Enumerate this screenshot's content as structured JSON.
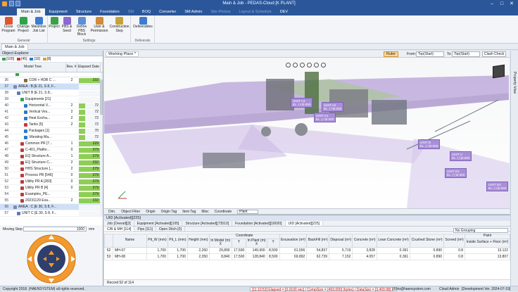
{
  "window": {
    "title": "Main & Job - PEDAS-Cloud [K PLANT]"
  },
  "ribbon_tabs": [
    {
      "label": "Main & Job",
      "state": "active"
    },
    {
      "label": "Equipment",
      "state": "normal"
    },
    {
      "label": "Structure",
      "state": "normal"
    },
    {
      "label": "Foundation",
      "state": "normal"
    },
    {
      "label": "SM",
      "state": "dim"
    },
    {
      "label": "BOQ",
      "state": "normal"
    },
    {
      "label": "Converter",
      "state": "normal"
    },
    {
      "label": "SM Admin",
      "state": "normal"
    },
    {
      "label": "Site Photos",
      "state": "dim"
    },
    {
      "label": "Layout & Schedule",
      "state": "dim"
    },
    {
      "label": "DEV",
      "state": "normal"
    }
  ],
  "ribbon": {
    "general": {
      "label": "General",
      "buttons": [
        "Close Program",
        "Change Project",
        "Maximize Job List"
      ]
    },
    "settings": {
      "label": "Settings",
      "buttons": [
        "Project",
        "PBS & Seed",
        "Define PBS Block",
        "User & Permission",
        "Construction Step"
      ]
    },
    "deliverables": {
      "label": "Deliverals",
      "buttons": [
        "Deliverables"
      ]
    }
  },
  "doc_tab": "Main & Job",
  "explorer": {
    "title": "Object Explorer",
    "counts": [
      "[105]",
      "[45]",
      "[19]",
      "[8]"
    ],
    "columns": {
      "model_tree": "Model Tree",
      "rev": "Rev. #",
      "elapsed": "Elapsed Date"
    },
    "rows": [
      {
        "num": "36",
        "name": "COR + HDB C ...",
        "rev": "2",
        "elapsed": "232",
        "fill": 1.0,
        "icon": "#8a6a3a",
        "indent": 4
      },
      {
        "num": "37",
        "name": "AREA : B [E 21, S 8, F...",
        "rev": "",
        "elapsed": "",
        "fill": 0,
        "icon": "#7a8ab8",
        "indent": 1,
        "selected": true
      },
      {
        "num": "38",
        "name": "UNIT B [E 21, S 8...",
        "rev": "",
        "elapsed": "",
        "fill": 0,
        "icon": "#5b7ab8",
        "indent": 2
      },
      {
        "num": "39",
        "name": "Equipments [21]",
        "rev": "",
        "elapsed": "",
        "fill": 0,
        "icon": "#3aa04a",
        "indent": 3
      },
      {
        "num": "40",
        "name": "Horizontal V...",
        "rev": "2",
        "elapsed": "72",
        "fill": 0.31,
        "icon": "#2b79c8",
        "indent": 4
      },
      {
        "num": "41",
        "name": "Vertical Ves...",
        "rev": "2",
        "elapsed": "72",
        "fill": 0.31,
        "icon": "#2b79c8",
        "indent": 4
      },
      {
        "num": "42",
        "name": "Heat Excha...",
        "rev": "2",
        "elapsed": "72",
        "fill": 0.31,
        "icon": "#2b79c8",
        "indent": 4
      },
      {
        "num": "43",
        "name": "Tanks [5]",
        "rev": "2",
        "elapsed": "72",
        "fill": 0.31,
        "icon": "#c03a3a",
        "indent": 4
      },
      {
        "num": "44",
        "name": "Packages [1]",
        "rev": "",
        "elapsed": "70",
        "fill": 0.3,
        "icon": "#2b79c8",
        "indent": 4
      },
      {
        "num": "45",
        "name": "Vibrating Ma...",
        "rev": "",
        "elapsed": "72",
        "fill": 0.31,
        "icon": "#2b79c8",
        "indent": 4
      },
      {
        "num": "46",
        "name": "Common PR [7...",
        "rev": "1",
        "elapsed": "229",
        "fill": 0.99,
        "icon": "#c03a3a",
        "indent": 3
      },
      {
        "num": "47",
        "name": "C-401_Platfor...",
        "rev": "0",
        "elapsed": "279",
        "fill": 1.0,
        "icon": "#c03a3a",
        "indent": 3
      },
      {
        "num": "48",
        "name": "EQ Structure A...",
        "rev": "1",
        "elapsed": "279",
        "fill": 1.0,
        "icon": "#c03a3a",
        "indent": 3
      },
      {
        "num": "49",
        "name": "EQ Structure C...",
        "rev": "2",
        "elapsed": "232",
        "fill": 1.0,
        "icon": "#c03a3a",
        "indent": 3
      },
      {
        "num": "50",
        "name": "HHS Structure [...",
        "rev": "2",
        "elapsed": "279",
        "fill": 1.0,
        "icon": "#c03a3a",
        "indent": 3
      },
      {
        "num": "51",
        "name": "Process PR [546]",
        "rev": "0",
        "elapsed": "279",
        "fill": 1.0,
        "icon": "#c03a3a",
        "indent": 3
      },
      {
        "num": "52",
        "name": "Utility PR A [283]",
        "rev": "0",
        "elapsed": "279",
        "fill": 1.0,
        "icon": "#c03a3a",
        "indent": 3
      },
      {
        "num": "53",
        "name": "Utility PR B [4]",
        "rev": "0",
        "elapsed": "279",
        "fill": 1.0,
        "icon": "#c03a3a",
        "indent": 3
      },
      {
        "num": "54",
        "name": "Examples_PE...",
        "rev": "",
        "elapsed": "279",
        "fill": 1.0,
        "icon": "#c03a3a",
        "indent": 3
      },
      {
        "num": "55",
        "name": "20231129 Exa...",
        "rev": "2",
        "elapsed": "232",
        "fill": 1.0,
        "icon": "#c03a3a",
        "indent": 3
      },
      {
        "num": "56",
        "name": "AREA : C [E 30, S 8, F...",
        "rev": "",
        "elapsed": "",
        "fill": 0,
        "icon": "#7a8ab8",
        "indent": 1,
        "selected": true
      },
      {
        "num": "57",
        "name": "UNIT C [E 30, S 8, F...",
        "rev": "",
        "elapsed": "",
        "fill": 0,
        "icon": "#5b7ab8",
        "indent": 2
      }
    ]
  },
  "move_step": {
    "label": "Moving Step :",
    "value": "1000",
    "unit": "mm"
  },
  "viewport": {
    "tab": "Working Place *",
    "ruler": "Ruler",
    "from_label": "From:",
    "from_value": "Top(Start)",
    "to_label": "To:",
    "to_value": "Top(Start)",
    "clash": "Clash Check",
    "unit_labels": [
      {
        "text": "UNIT A3\nEL. (+)0.000"
      },
      {
        "text": "UNIT A2\nEL. (+)0.000"
      },
      {
        "text": "UNIT A1\nEL. (+)0.000"
      },
      {
        "text": "UNIT B\nEL. (+)0.000"
      },
      {
        "text": "UNIT C\nEL. (+)0.000"
      },
      {
        "text": "UNIT D1\nEL. (+)0.000"
      },
      {
        "text": "UNIT D2\nEL. (+)0.000"
      }
    ],
    "bottom_tools": [
      "Dim.",
      "Object Filter",
      "Origin",
      "Origin Tag",
      "Item Tag",
      "Misc"
    ],
    "coordinate_label": "Coordinate",
    "coordinate_value": "Plant"
  },
  "properties_tab": "Property View",
  "bottom": {
    "title": "UID [Activated][225]",
    "tabs1": [
      "Job [Overall][3]",
      "Equipment [Activated][105]",
      "Structure [Activated][73510]",
      "Foundation [Activated][18020]",
      "UID [Activated][225]"
    ],
    "tabs2": [
      "C/B & MH [114]",
      "Pips [111]",
      "Open Ditch [0]"
    ],
    "grouping": "No Grouping",
    "columns": [
      "Name",
      "Pit_W (mm)",
      "Pit_L (mm)",
      "Height (mm)",
      "In Model X",
      "In Model Y",
      "In Plant X",
      "In Plant Y",
      "Excavation (m³)",
      "BackFill (m³)",
      "Disposal (m³)",
      "Concrete (m³)",
      "Lean Concrete (m³)",
      "Crushed Stone (m³)",
      "Screed (m²)",
      "Inside Surface + Floor (m²)"
    ],
    "coord_head": "Coordinate",
    "in_model": "In Model (m)",
    "in_plant": "In Plant (m)",
    "paint_head": "Paint",
    "rows": [
      {
        "idx": "52",
        "name": "MH-07",
        "cells": [
          "1,700",
          "1,700",
          "2,260",
          "29,890",
          "17,500",
          "149,900",
          "8,500",
          "61,556",
          "54,837",
          "6,719",
          "3,828",
          "0.361",
          "0.890",
          "0.8",
          "13.122"
        ]
      },
      {
        "idx": "53",
        "name": "MH-08",
        "cells": [
          "1,700",
          "1,700",
          "2,350",
          "8,840",
          "17,500",
          "128,840",
          "8,500",
          "69.892",
          "62.739",
          "7.152",
          "4.057",
          "0.361",
          "0.890",
          "0.8",
          "13.807"
        ]
      }
    ],
    "record_text": "Record 52 of 114"
  },
  "status": {
    "copyright": "Copyright 2018. (HAENSYSTEM) all rights reserved.",
    "elapsed": "[11:10:53] Elapsed = [0.0100 sec] / CompSize = [493,000] (bytes) / DataSize = [3,409.98] ...",
    "user": "jdcho@haensystem.com",
    "role": "Cloud Admin",
    "version": "[Development Ver. 2024-07-19]"
  },
  "colors": {
    "accent": "#2b579a",
    "bar_fill": "#8fce55",
    "unit_label": "#a98fd8"
  }
}
